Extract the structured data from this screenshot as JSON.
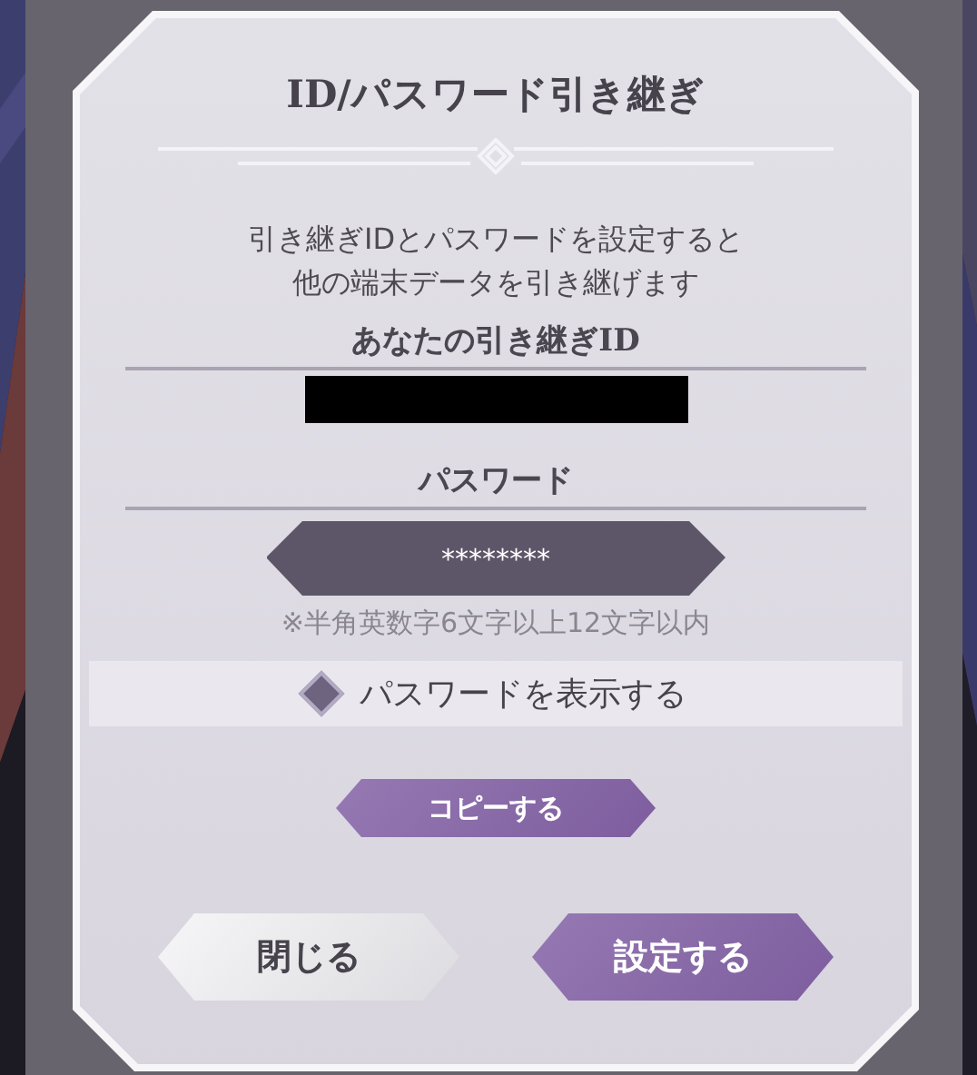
{
  "dialog": {
    "title": "ID/パスワード引き継ぎ",
    "description": [
      "引き継ぎIDとパスワードを設定すると",
      "他の端末データを引き継げます"
    ],
    "id_section": {
      "label": "あなたの引き継ぎID",
      "redacted": true
    },
    "password_section": {
      "label": "パスワード",
      "value": "********",
      "hint": "※半角英数字6文字以上12文字以内"
    },
    "show_password": {
      "label": "パスワードを表示する",
      "checked": false
    },
    "copy_button": {
      "label": "コピーする"
    },
    "buttons": [
      {
        "label": "閉じる",
        "kind": "secondary"
      },
      {
        "label": "設定する",
        "kind": "primary"
      }
    ]
  }
}
